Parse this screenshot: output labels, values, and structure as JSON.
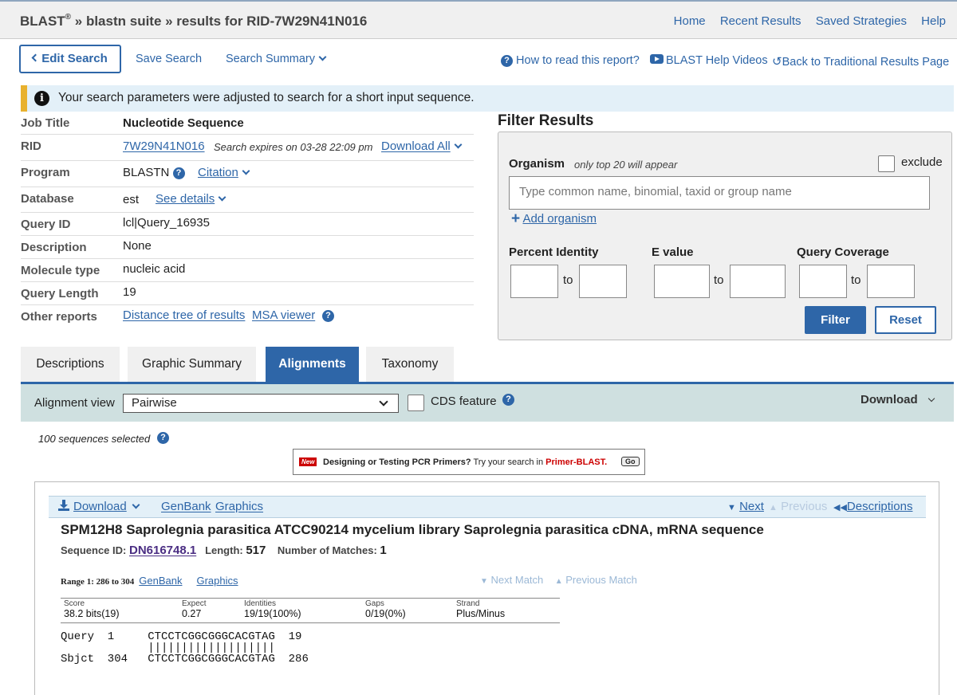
{
  "header": {
    "blast": "BLAST",
    "reg": "®",
    "path": " » blastn suite » results for RID-7W29N41N016",
    "nav": [
      "Home",
      "Recent Results",
      "Saved Strategies",
      "Help"
    ]
  },
  "toolbar": {
    "edit_search": "Edit Search",
    "save_search": "Save Search",
    "search_summary": "Search Summary",
    "how_to_read": "How to read this report?",
    "help_videos": "BLAST Help Videos",
    "back_traditional": "Back to Traditional Results Page"
  },
  "banner": {
    "icon": "i",
    "text": "Your search parameters were adjusted to search for a short input sequence."
  },
  "job": {
    "job_title_label": "Job Title",
    "job_title": "Nucleotide Sequence",
    "rid_label": "RID",
    "rid": "7W29N41N016",
    "expires": "Search expires on 03-28 22:09 pm",
    "download_all": "Download All",
    "program_label": "Program",
    "program": "BLASTN",
    "citation": "Citation",
    "database_label": "Database",
    "database": "est",
    "see_details": "See details",
    "query_id_label": "Query ID",
    "query_id": "lcl|Query_16935",
    "description_label": "Description",
    "description": "None",
    "molecule_label": "Molecule type",
    "molecule": "nucleic acid",
    "query_length_label": "Query Length",
    "query_length": "19",
    "other_reports_label": "Other reports",
    "distance_tree": "Distance tree of results",
    "msa_viewer": "MSA viewer"
  },
  "filter": {
    "title": "Filter Results",
    "organism_label": "Organism",
    "organism_note": "only top 20 will appear",
    "exclude": "exclude",
    "organism_placeholder": "Type common  name, binomial, taxid or group  name",
    "add_organism": "Add organism",
    "percent_identity": "Percent Identity",
    "e_value": "E value",
    "query_coverage": "Query Coverage",
    "to": "to",
    "filter_btn": "Filter",
    "reset_btn": "Reset"
  },
  "tabs": [
    "Descriptions",
    "Graphic Summary",
    "Alignments",
    "Taxonomy"
  ],
  "alignment_bar": {
    "view_label": "Alignment view",
    "view_value": "Pairwise",
    "cds_feature": "CDS feature",
    "download": "Download"
  },
  "selected": "100 sequences selected",
  "primer_banner": {
    "new": "New",
    "text_bold": "Designing or Testing PCR Primers?",
    "text_mid": " Try your search in ",
    "text_link": "Primer-BLAST.",
    "go": "Go"
  },
  "result": {
    "download": "Download",
    "genbank": "GenBank",
    "graphics": "Graphics",
    "next": "Next",
    "previous": "Previous",
    "descriptions": "Descriptions",
    "title": "SPM12H8 Saprolegnia parasitica ATCC90214 mycelium library Saprolegnia parasitica cDNA, mRNA sequence",
    "seq_id_label": "Sequence ID:",
    "seq_id": "DN616748.1",
    "length_label": "Length:",
    "length": "517",
    "matches_label": "Number of Matches:",
    "matches": "1",
    "range": "Range 1: 286 to 304",
    "next_match": "Next Match",
    "previous_match": "Previous Match",
    "stats": {
      "score_h": "Score",
      "score": "38.2 bits(19)",
      "expect_h": "Expect",
      "expect": "0.27",
      "identities_h": "Identities",
      "identities": "19/19(100%)",
      "gaps_h": "Gaps",
      "gaps": "0/19(0%)",
      "strand_h": "Strand",
      "strand": "Plus/Minus"
    },
    "alignment_lines": [
      "Query  1     CTCCTCGGCGGGCACGTAG  19",
      "             |||||||||||||||||||",
      "Sbjct  304   CTCCTCGGCGGGCACGTAG  286"
    ]
  }
}
